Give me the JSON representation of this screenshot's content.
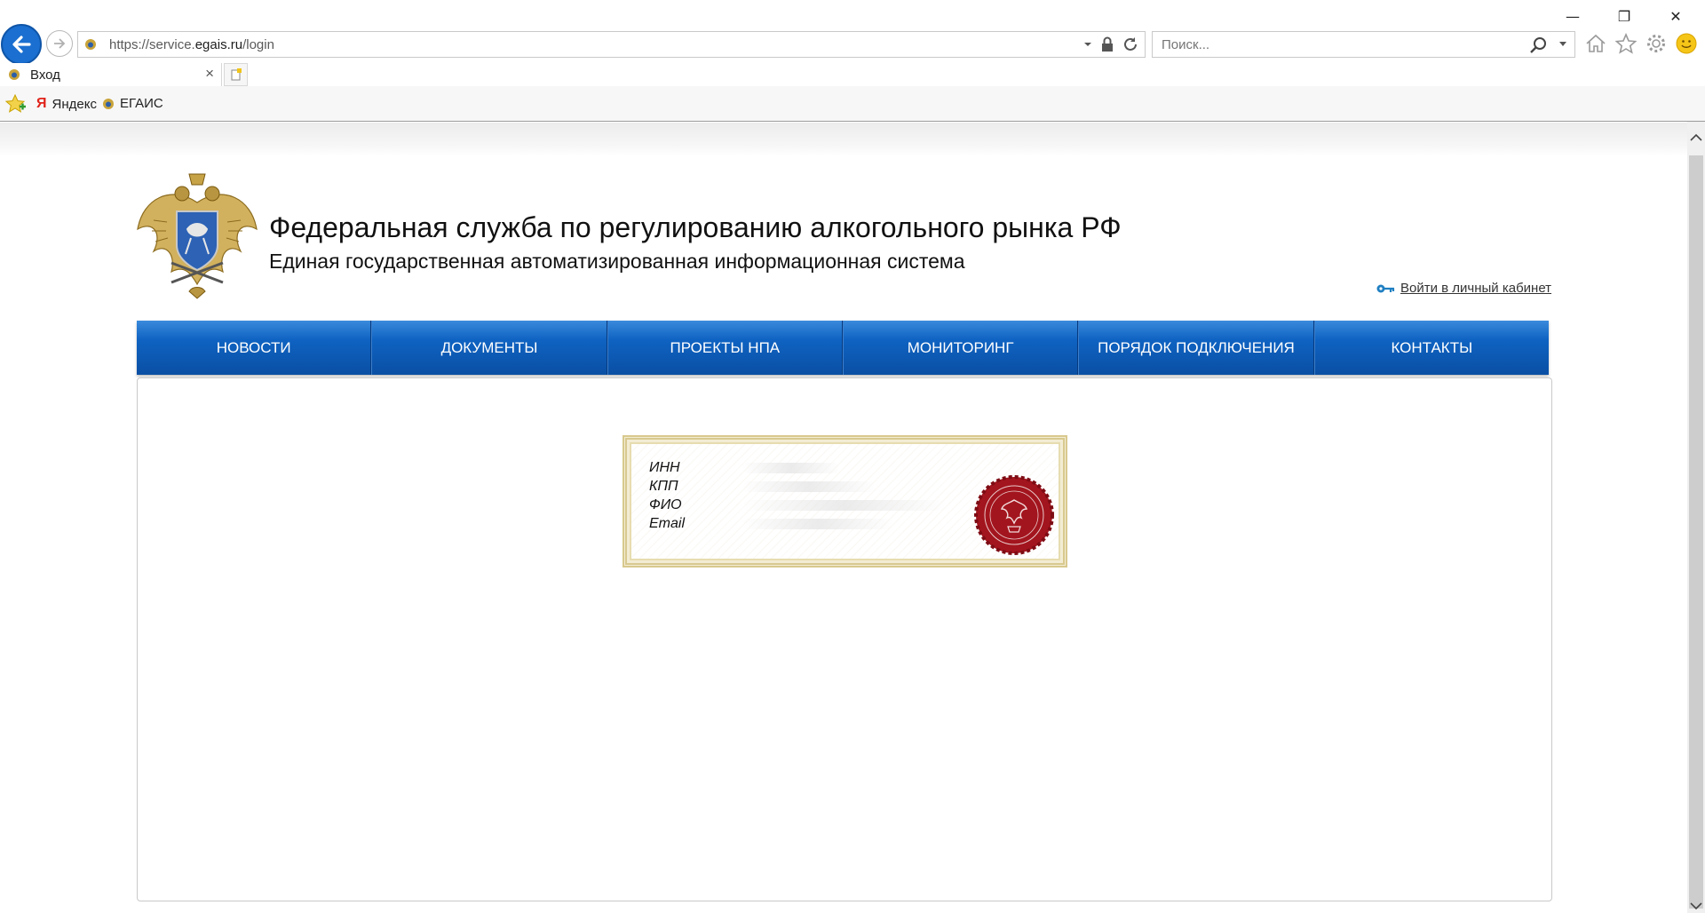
{
  "browser": {
    "url_prefix": "https://service.",
    "url_domain": "egais.ru",
    "url_path": "/login",
    "search_placeholder": "Поиск...",
    "tab_title": "Вход",
    "tab_close": "×",
    "window_controls": {
      "minimize": "—",
      "restore": "❐",
      "close": "✕"
    },
    "favorites": [
      {
        "icon": "yandex-icon",
        "glyph": "Я",
        "label": "Яндекс"
      },
      {
        "icon": "egais-eagle-icon",
        "label": "ЕГАИС"
      }
    ],
    "icons": [
      "back-arrow-icon",
      "forward-arrow-icon",
      "dropdown-icon",
      "lock-icon",
      "refresh-icon",
      "search-icon",
      "home-icon",
      "favorites-star-icon",
      "gear-icon",
      "smiley-feedback-icon"
    ]
  },
  "header": {
    "title": "Федеральная служба по регулированию алкогольного рынка РФ",
    "subtitle": "Единая государственная автоматизированная информационная система",
    "login_link": "Войти в личный кабинет"
  },
  "nav": {
    "items": [
      {
        "label": "НОВОСТИ"
      },
      {
        "label": "ДОКУМЕНТЫ"
      },
      {
        "label": "ПРОЕКТЫ НПА"
      },
      {
        "label": "МОНИТОРИНГ"
      },
      {
        "label": "ПОРЯДОК ПОДКЛЮЧЕНИЯ"
      },
      {
        "label": "КОНТАКТЫ"
      }
    ],
    "color": "#0f5fbd"
  },
  "certificate": {
    "fields": [
      "ИНН",
      "КПП",
      "ФИО",
      "Email"
    ],
    "border_color": "#d8c98e",
    "seal_color": "#a3151e"
  }
}
